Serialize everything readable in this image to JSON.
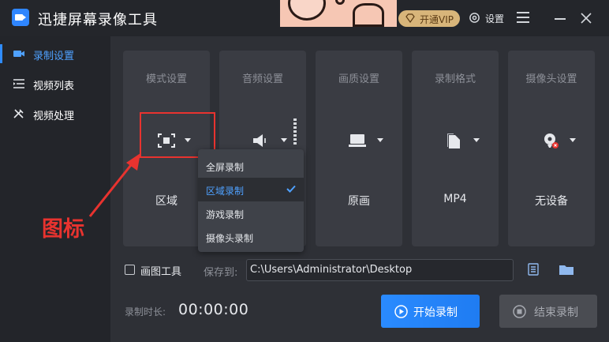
{
  "app": {
    "title": "迅捷屏幕录像工具"
  },
  "header": {
    "vip_label": "开通VIP",
    "settings_label": "设置"
  },
  "sidebar": {
    "items": [
      {
        "label": "录制设置",
        "icon": "video-camera-icon",
        "active": true
      },
      {
        "label": "视频列表",
        "icon": "list-icon",
        "active": false
      },
      {
        "label": "视频处理",
        "icon": "tools-icon",
        "active": false
      }
    ]
  },
  "cards": [
    {
      "title": "模式设置",
      "value": "区域",
      "icon": "region-select-icon"
    },
    {
      "title": "音频设置",
      "value": "",
      "icon": "speaker-icon"
    },
    {
      "title": "画质设置",
      "value": "原画",
      "icon": "monitor-icon"
    },
    {
      "title": "录制格式",
      "value": "MP4",
      "icon": "file-icon"
    },
    {
      "title": "摄像头设置",
      "value": "无设备",
      "icon": "webcam-disabled-icon"
    }
  ],
  "mode_dropdown": {
    "options": [
      "全屏录制",
      "区域录制",
      "游戏录制",
      "摄像头录制"
    ],
    "selected": "区域录制"
  },
  "annotation": {
    "label": "图标"
  },
  "bottom": {
    "draw_tool_label": "画图工具",
    "draw_tool_checked": false,
    "save_to_label": "保存到:",
    "save_path": "C:\\Users\\Administrator\\Desktop",
    "duration_label": "录制时长:",
    "duration_value": "00:00:00",
    "start_label": "开始录制",
    "stop_label": "结束录制"
  },
  "colors": {
    "accent": "#2f8cff",
    "annotation_red": "#e8332f",
    "vip_gold": "#d8b57a"
  }
}
